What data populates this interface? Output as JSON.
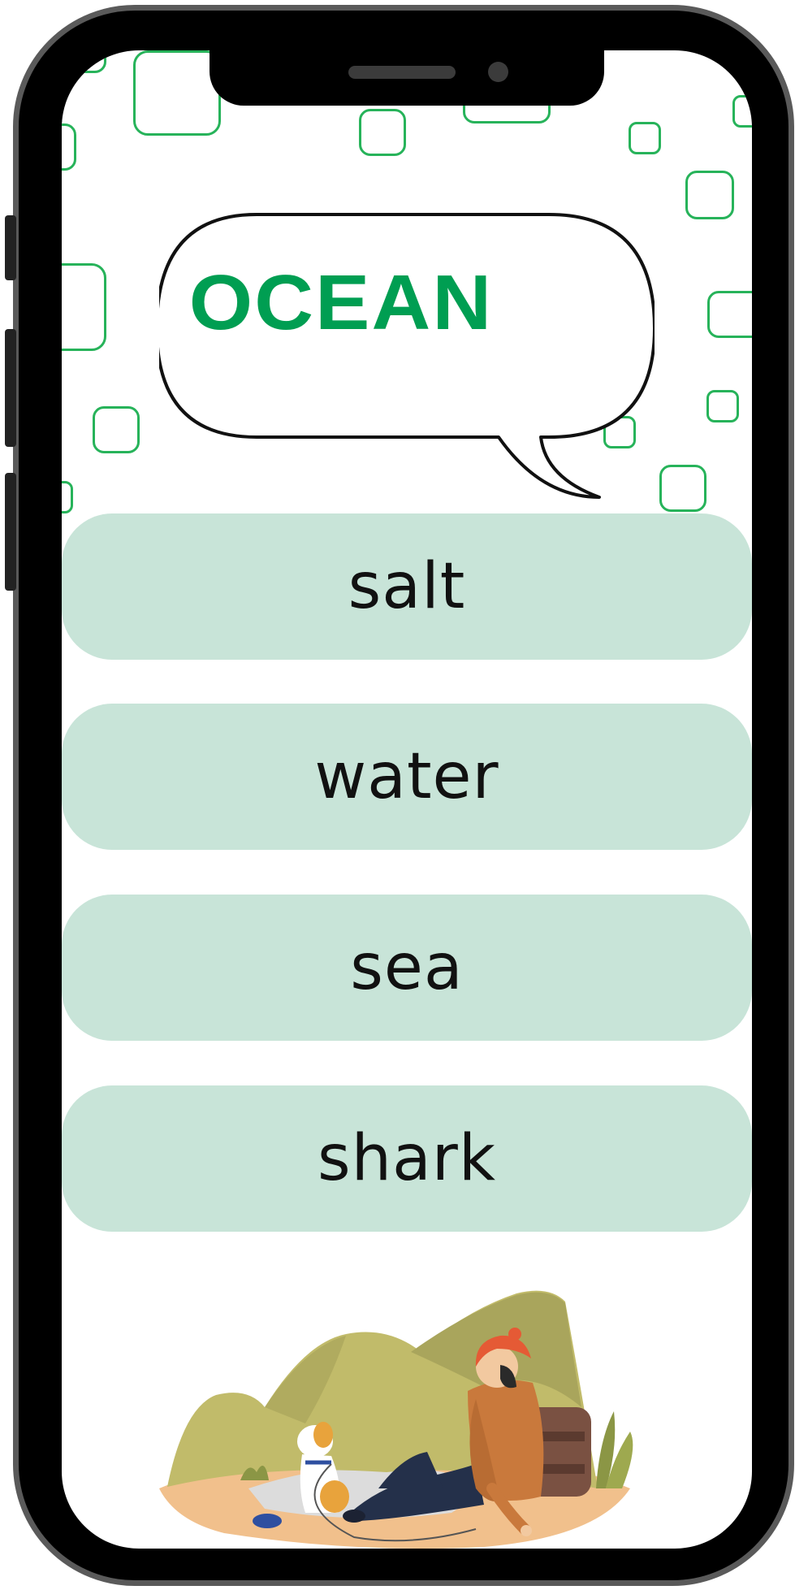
{
  "quiz": {
    "title": "OCEAN",
    "options": [
      {
        "label": "salt"
      },
      {
        "label": "water"
      },
      {
        "label": "sea"
      },
      {
        "label": "shark"
      }
    ]
  },
  "colors": {
    "accent": "#009e52",
    "square_outline": "#27b35a",
    "option_background": "#c8e4d8",
    "frame": "#000000"
  },
  "icons": {
    "illustration": "hiker-with-dog-illustration"
  }
}
